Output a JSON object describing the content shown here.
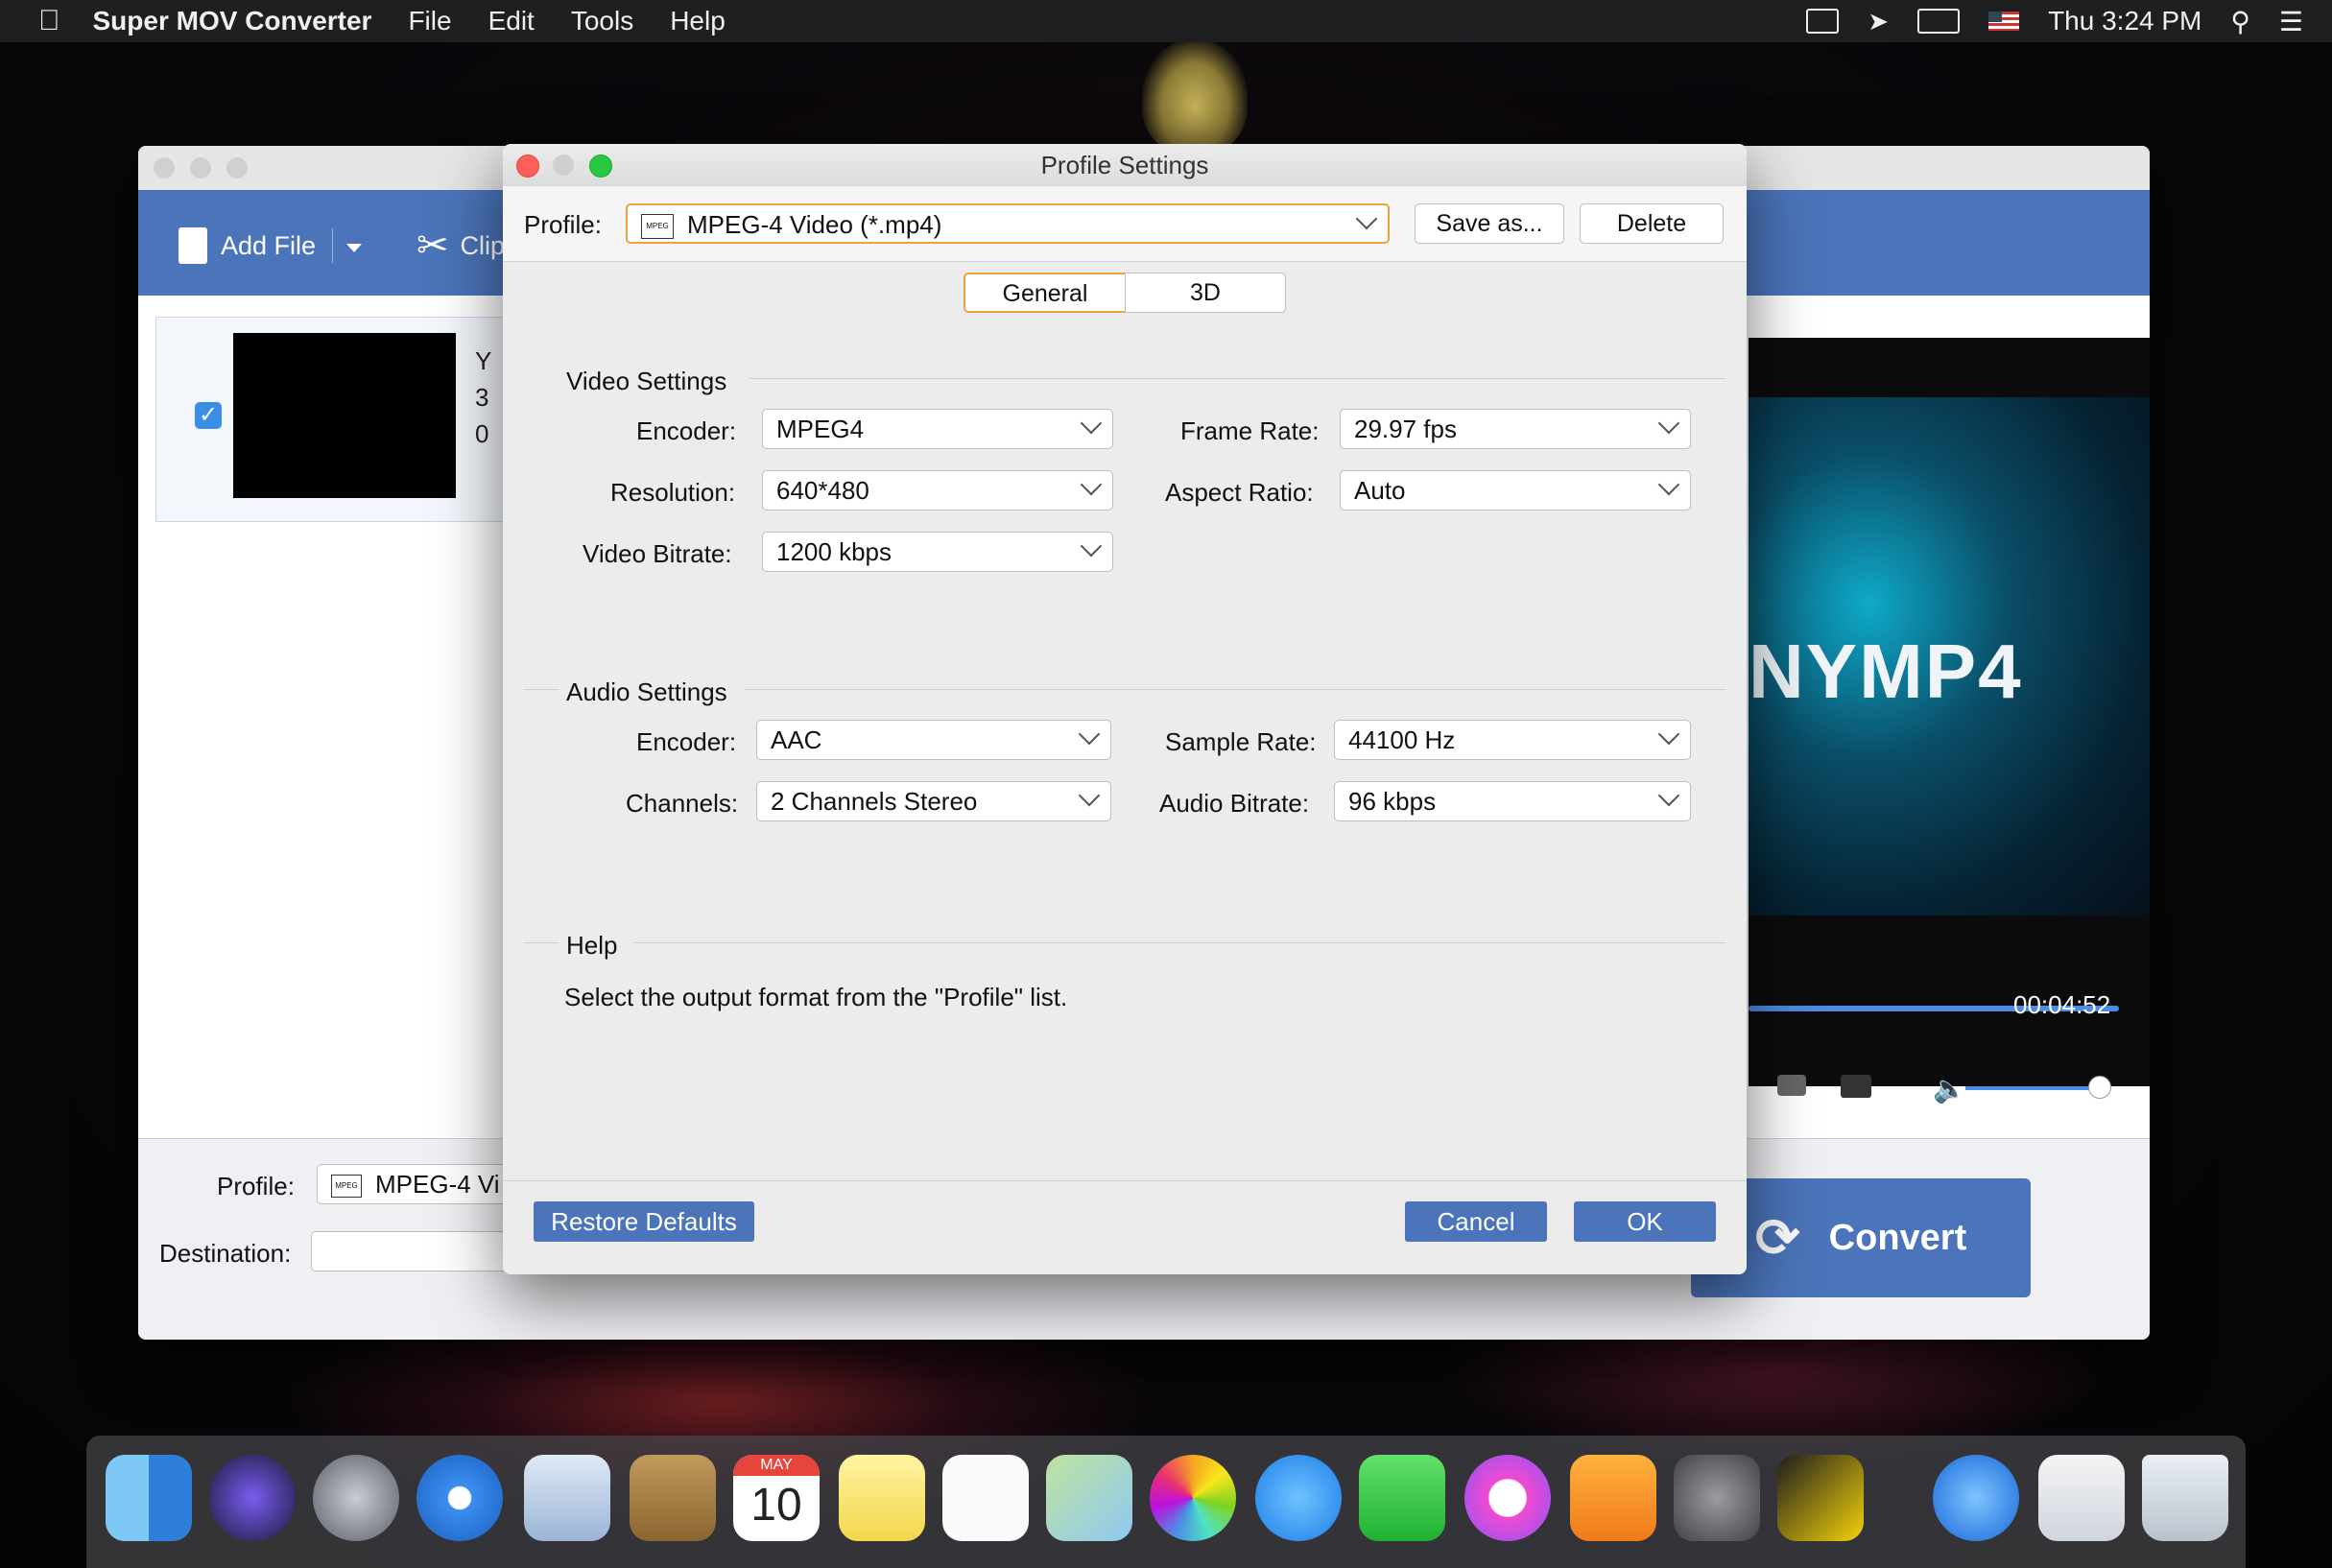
{
  "menubar": {
    "app_name": "Super MOV Converter",
    "menus": [
      "File",
      "Edit",
      "Tools",
      "Help"
    ],
    "clock": "Thu 3:24 PM"
  },
  "main_window": {
    "toolbar": {
      "add_file": "Add File",
      "clip": "Clip"
    },
    "file_item_partial": [
      "Y",
      "3",
      "0"
    ],
    "preview": {
      "logo_text": "NYMP4",
      "time": "00:04:52"
    },
    "bottom": {
      "profile_label": "Profile:",
      "profile_value": "MPEG-4 Vi",
      "destination_label": "Destination:"
    },
    "convert_label": "Convert"
  },
  "dialog": {
    "title": "Profile Settings",
    "profile_label": "Profile:",
    "profile_value": "MPEG-4 Video (*.mp4)",
    "profile_icon_text": "MPEG",
    "save_as": "Save as...",
    "delete": "Delete",
    "tabs": [
      "General",
      "3D"
    ],
    "video": {
      "heading": "Video Settings",
      "encoder_label": "Encoder:",
      "encoder": "MPEG4",
      "resolution_label": "Resolution:",
      "resolution": "640*480",
      "bitrate_label": "Video Bitrate:",
      "bitrate": "1200 kbps",
      "framerate_label": "Frame Rate:",
      "framerate": "29.97 fps",
      "aspect_label": "Aspect Ratio:",
      "aspect": "Auto"
    },
    "audio": {
      "heading": "Audio Settings",
      "encoder_label": "Encoder:",
      "encoder": "AAC",
      "channels_label": "Channels:",
      "channels": "2 Channels Stereo",
      "samplerate_label": "Sample Rate:",
      "samplerate": "44100 Hz",
      "bitrate_label": "Audio Bitrate:",
      "bitrate": "96 kbps"
    },
    "help": {
      "heading": "Help",
      "text": "Select the output format from the \"Profile\" list."
    },
    "restore_defaults": "Restore Defaults",
    "cancel": "Cancel",
    "ok": "OK"
  },
  "dock": {
    "calendar_month": "MAY",
    "calendar_day": "10",
    "apps": [
      "finder-icon",
      "siri-icon",
      "launchpad-icon",
      "safari-icon",
      "mail-icon",
      "contacts-icon",
      "calendar-icon",
      "notes-icon",
      "reminders-icon",
      "maps-icon",
      "photos-icon",
      "messages-icon",
      "facetime-icon",
      "itunes-icon",
      "ibooks-icon",
      "system-preferences-icon",
      "mov-converter-icon",
      "app-store-icon",
      "preview-icon",
      "trash-icon"
    ]
  }
}
